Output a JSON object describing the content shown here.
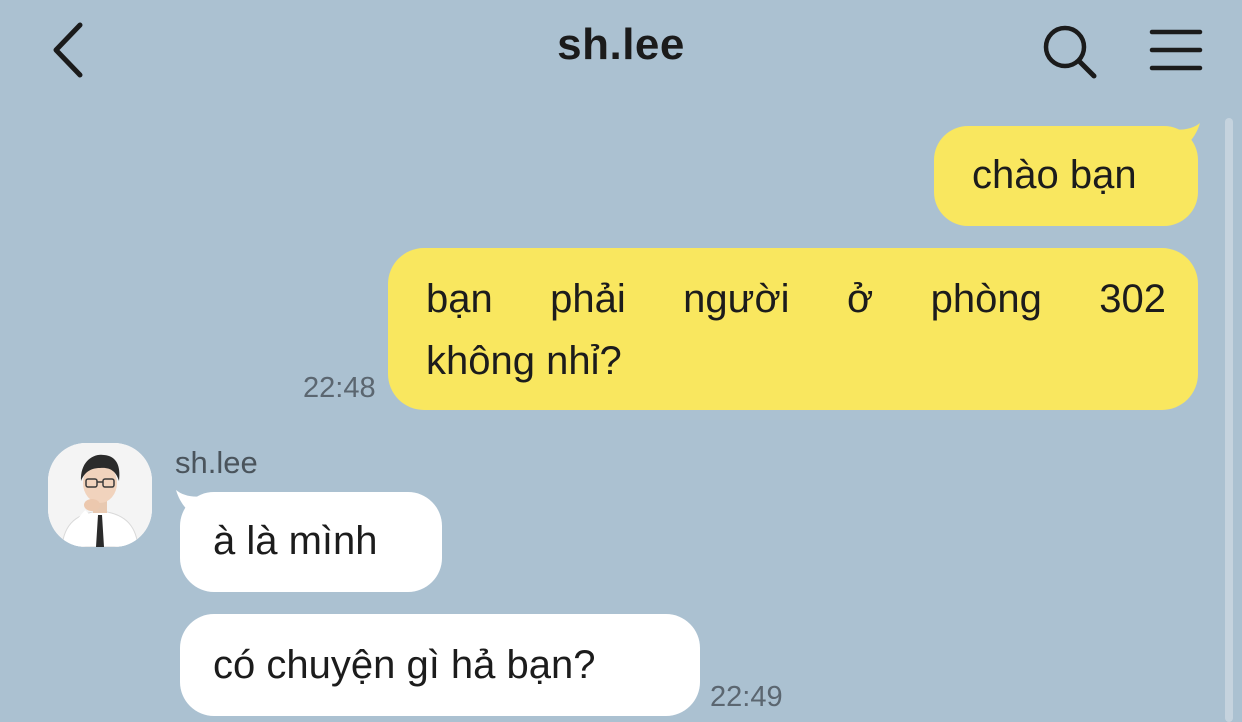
{
  "header": {
    "title": "sh.lee"
  },
  "messages": {
    "m1": {
      "text": "chào bạn"
    },
    "m2": {
      "line1": "bạn phải người ở phòng 302",
      "line2": "không nhỉ?",
      "time": "22:48"
    },
    "sender": "sh.lee",
    "m3": {
      "text": "à là mình"
    },
    "m4": {
      "text": "có chuyện gì hả bạn?",
      "time": "22:49"
    }
  },
  "colors": {
    "background": "#abc1d1",
    "outgoing_bubble": "#f9e75f",
    "incoming_bubble": "#ffffff",
    "text": "#1c1c1c",
    "meta_text": "#5b6670"
  },
  "icons": {
    "back": "chevron-left-icon",
    "search": "search-icon",
    "menu": "hamburger-menu-icon"
  }
}
